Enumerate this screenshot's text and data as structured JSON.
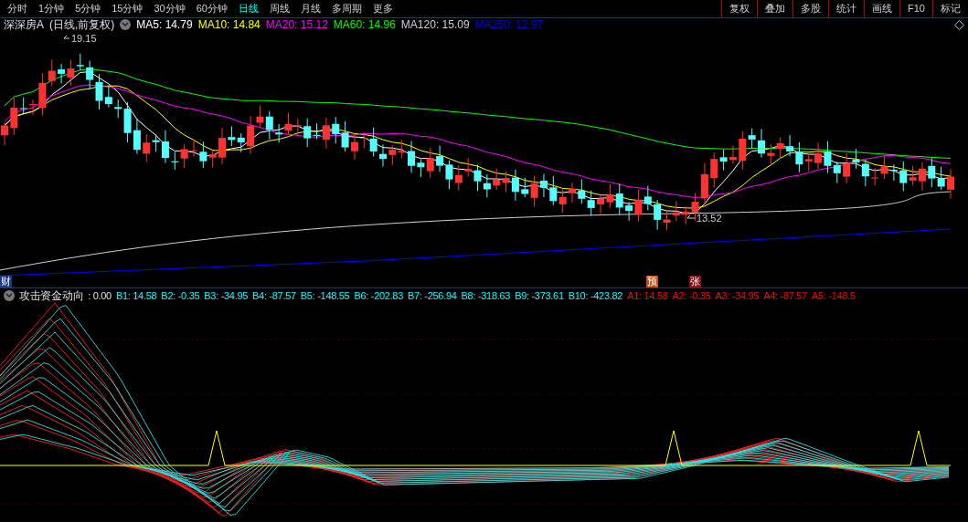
{
  "menu": {
    "tabs": [
      {
        "label": "分时",
        "selected": false
      },
      {
        "label": "1分钟",
        "selected": false
      },
      {
        "label": "5分钟",
        "selected": false
      },
      {
        "label": "15分钟",
        "selected": false
      },
      {
        "label": "30分钟",
        "selected": false
      },
      {
        "label": "60分钟",
        "selected": false
      },
      {
        "label": "日线",
        "selected": true
      },
      {
        "label": "周线",
        "selected": false
      },
      {
        "label": "月线",
        "selected": false
      },
      {
        "label": "多周期",
        "selected": false
      },
      {
        "label": "更多",
        "selected": false
      }
    ],
    "buttons": [
      "复权",
      "叠加",
      "多股",
      "统计",
      "画线",
      "F10",
      "标记"
    ]
  },
  "stock": {
    "name": "深深房A",
    "period": "(日线,前复权)"
  },
  "ma_legend": [
    {
      "label": "MA5: 14.79",
      "color": "#ffffff"
    },
    {
      "label": "MA10: 14.84",
      "color": "#ffff00"
    },
    {
      "label": "MA20: 15.12",
      "color": "#ff00ff"
    },
    {
      "label": "MA60: 14.96",
      "color": "#00ff00"
    },
    {
      "label": "MA120: 15.09",
      "color": "#d0d0d0"
    },
    {
      "label": "MA250: 12.97",
      "color": "#0000ff"
    }
  ],
  "price_labels": [
    {
      "kind": "high",
      "text": "19.15"
    },
    {
      "kind": "low",
      "text": "13.52"
    }
  ],
  "markers": [
    {
      "kind": "finance",
      "text": "财"
    },
    {
      "kind": "forecast",
      "text": "预"
    },
    {
      "kind": "rise",
      "text": "张"
    }
  ],
  "indicator": {
    "name": "攻击资金动向",
    "value": ": 0.00",
    "legend": [
      {
        "label": "B1: 14.58",
        "color": "#00ffff"
      },
      {
        "label": "B2: -0.35",
        "color": "#00ffff"
      },
      {
        "label": "B3: -34.95",
        "color": "#00ffff"
      },
      {
        "label": "B4: -87.57",
        "color": "#00ffff"
      },
      {
        "label": "B5: -148.55",
        "color": "#00ffff"
      },
      {
        "label": "B6: -202.83",
        "color": "#00ffff"
      },
      {
        "label": "B7: -256.94",
        "color": "#00ffff"
      },
      {
        "label": "B8: -318.63",
        "color": "#00ffff"
      },
      {
        "label": "B9: -373.61",
        "color": "#00ffff"
      },
      {
        "label": "B10: -423.82",
        "color": "#00ffff"
      },
      {
        "label": "A1: 14.58",
        "color": "#ff0000"
      },
      {
        "label": "A2: -0.35",
        "color": "#ff0000"
      },
      {
        "label": "A3: -34.95",
        "color": "#ff0000"
      },
      {
        "label": "A4: -87.57",
        "color": "#ff0000"
      },
      {
        "label": "A5: -148.5",
        "color": "#ff0000"
      }
    ]
  }
}
